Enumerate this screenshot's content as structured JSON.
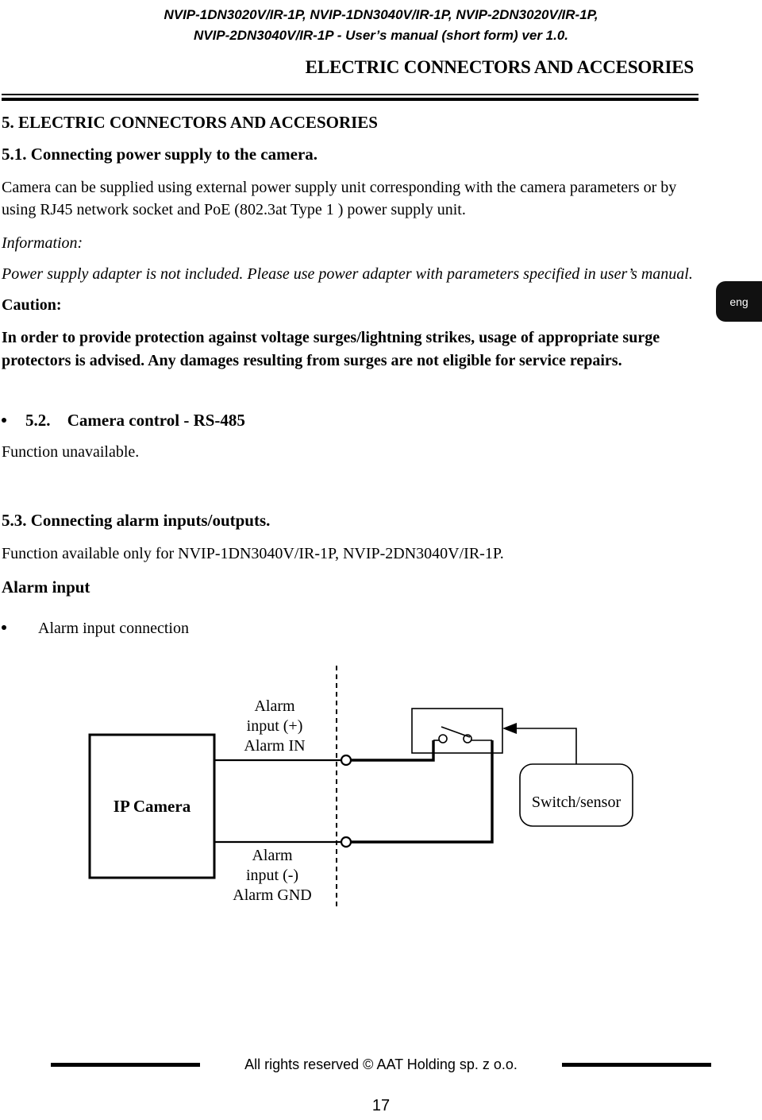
{
  "header": {
    "doc_title_line1": "NVIP-1DN3020V/IR-1P, NVIP-1DN3040V/IR-1P, NVIP-2DN3020V/IR-1P,",
    "doc_title_line2": "NVIP-2DN3040V/IR-1P - User’s manual (short form) ver 1.0.",
    "chapter_title": "ELECTRIC CONNECTORS AND ACCESORIES"
  },
  "language_tab": {
    "label": "eng"
  },
  "body": {
    "section_5_title": "5. ELECTRIC CONNECTORS AND ACCESORIES",
    "section_51_title": "5.1. Connecting  power supply to the camera.",
    "paragraph_power": "Camera can be supplied using external power supply unit corresponding with the camera parameters or by using RJ45 network socket and PoE (802.3at Type 1 ) power supply unit.",
    "information_label": "Information:",
    "information_text": "Power supply adapter is not included. Please use power adapter with parameters specified in user’s manual.",
    "caution_label": "Caution:",
    "caution_text": "In order to provide protection against voltage surges/lightning strikes, usage of appropriate surge protectors is advised. Any damages resulting from surges are not eligible for service repairs.",
    "section_52_number": "5.2.",
    "section_52_title": "Camera control - RS-485",
    "section_52_body": "Function unavailable.",
    "section_53_title": "5.3. Connecting alarm inputs/outputs.",
    "section_53_body": "Function available only for NVIP-1DN3040V/IR-1P, NVIP-2DN3040V/IR-1P.",
    "alarm_input_heading": "Alarm input",
    "alarm_input_bullet": "Alarm input connection"
  },
  "diagram": {
    "camera_box_label": "IP Camera",
    "alarm_in_label": "Alarm\ninput (+)\nAlarm IN",
    "alarm_in_line1": "Alarm",
    "alarm_in_line2": "input (+)",
    "alarm_in_line3": "Alarm IN",
    "alarm_gnd_line1": "Alarm",
    "alarm_gnd_line2": "input (-)",
    "alarm_gnd_line3": "Alarm GND",
    "switch_sensor_label": "Switch/sensor"
  },
  "footer": {
    "copyright": "All rights reserved © AAT Holding sp. z o.o.",
    "page_number": "17"
  }
}
